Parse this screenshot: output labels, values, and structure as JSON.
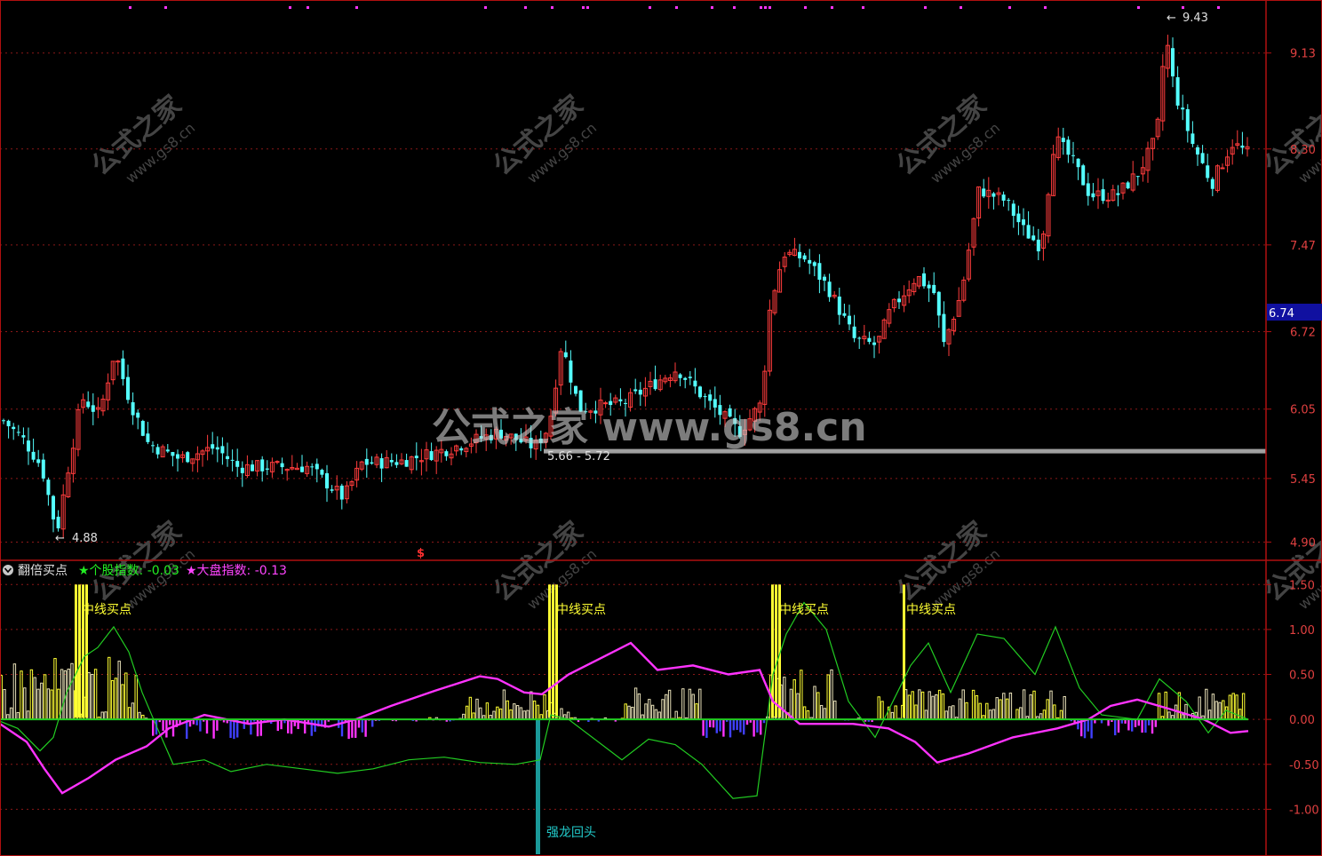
{
  "colors": {
    "background": "#000000",
    "frame": "#b01010",
    "grid": "#8a1818",
    "axis_text": "#e04040",
    "up_candle": "#ff3c3c",
    "down_candle": "#54ffff",
    "support_line": "#a0a0a0",
    "indicator_green": "#22cc22",
    "indicator_magenta": "#ff33ff",
    "signal_yellow": "#ffff33",
    "bar_cream": "#e8e0b8",
    "bar_blue": "#4040ff",
    "dragon_bar": "#1a9a9a",
    "last_price_bg": "#1010a0",
    "top_dots": "#ff33ff",
    "text_white": "#e0e0e0"
  },
  "price_panel": {
    "annotations": {
      "high": "9.43",
      "low": "4.88",
      "range": "5.66 - 5.72",
      "dollar": "$"
    },
    "last_price": "6.74"
  },
  "indicator_panel": {
    "name": "翻倍买点",
    "stock_index_label": "★个股指数: -0.03",
    "market_index_label": "★大盘指数: -0.13",
    "signal_label": "中线买点",
    "dragon_label": "强龙回头"
  },
  "watermark": {
    "small": "公式之家",
    "small_url": "www.gs8.cn",
    "center": "公式之家 www.gs8.cn"
  },
  "chart_data": [
    {
      "type": "candlestick",
      "y_ticks": [
        "9.13",
        "8.30",
        "7.47",
        "6.72",
        "6.05",
        "5.45",
        "4.90"
      ],
      "ylim": [
        4.75,
        9.55
      ],
      "high": 9.43,
      "low": 4.88,
      "support_level": [
        5.66,
        5.72
      ],
      "last_price": 6.74
    },
    {
      "type": "line",
      "y_ticks": [
        "1.50",
        "1.00",
        "0.50",
        "0.00",
        "-0.50",
        "-1.00"
      ],
      "ylim": [
        -1.5,
        1.75
      ],
      "series": [
        {
          "name": "个股指数",
          "last": -0.03
        },
        {
          "name": "大盘指数",
          "last": -0.13
        }
      ]
    }
  ]
}
